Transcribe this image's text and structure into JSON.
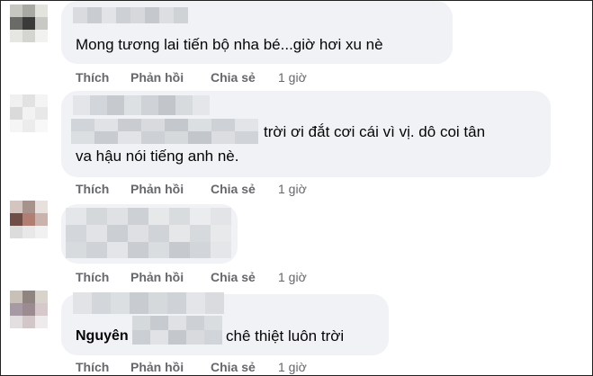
{
  "actions": {
    "like": "Thích",
    "reply": "Phản hồi",
    "share": "Chia sẻ"
  },
  "comments": [
    {
      "text_lines": [
        "Mong tương lai tiến bộ nha bé...giờ hơi xu nè"
      ],
      "time": "1 giờ"
    },
    {
      "text_lines": [
        "trời ơi đắt cơi cái vì vị. dô coi tân",
        "va hậu nói tiếng anh nè."
      ],
      "time": "1 giờ"
    },
    {
      "text_lines": [],
      "time": "1 giờ"
    },
    {
      "name_visible": "Nguyên",
      "text_lines": [
        "chê thiệt luôn trời"
      ],
      "time": "1 giờ"
    }
  ],
  "colors": {
    "bubble": "#f0f2f5",
    "text": "#050505",
    "meta": "#65676b"
  }
}
